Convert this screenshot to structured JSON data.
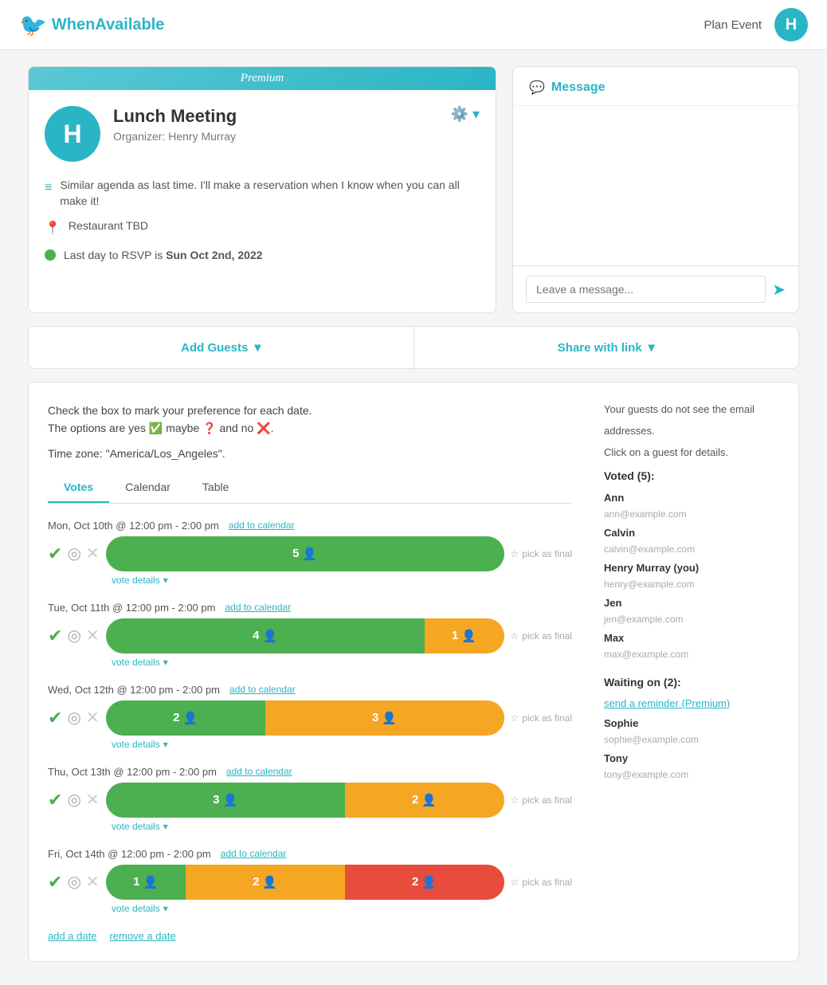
{
  "header": {
    "logo_text": "WhenAvailable",
    "plan_event": "Plan Event",
    "user_initial": "H"
  },
  "event_card": {
    "premium_label": "Premium",
    "title": "Lunch Meeting",
    "organizer": "Organizer: Henry Murray",
    "user_initial": "H",
    "description": "Similar agenda as last time. I'll make a reservation when I know when you can all make it!",
    "location": "Restaurant TBD",
    "rsvp_text": "Last day to RSVP is ",
    "rsvp_date": "Sun Oct 2nd, 2022"
  },
  "message_panel": {
    "title": "Message",
    "placeholder": "Leave a message..."
  },
  "actions": {
    "add_guests": "Add Guests",
    "share_link": "Share with link"
  },
  "voting": {
    "instruction1": "Check the box to mark your preference for each date.",
    "instruction2": "The options are yes",
    "instruction3": "maybe",
    "instruction4": "and no",
    "timezone_label": "Time zone:",
    "timezone_value": "\"America/Los_Angeles\"",
    "tabs": [
      "Votes",
      "Calendar",
      "Table"
    ],
    "active_tab": "Votes",
    "dates": [
      {
        "label": "Mon, Oct 10th @ 12:00 pm - 2:00 pm",
        "green_count": 5,
        "yellow_count": 0,
        "red_count": 0,
        "green_pct": 100,
        "yellow_pct": 0,
        "red_pct": 0,
        "pick_label": "pick as final"
      },
      {
        "label": "Tue, Oct 11th @ 12:00 pm - 2:00 pm",
        "green_count": 4,
        "yellow_count": 1,
        "red_count": 0,
        "green_pct": 80,
        "yellow_pct": 20,
        "red_pct": 0,
        "pick_label": "pick as final"
      },
      {
        "label": "Wed, Oct 12th @ 12:00 pm - 2:00 pm",
        "green_count": 2,
        "yellow_count": 3,
        "red_count": 0,
        "green_pct": 40,
        "yellow_pct": 60,
        "red_pct": 0,
        "pick_label": "pick as final"
      },
      {
        "label": "Thu, Oct 13th @ 12:00 pm - 2:00 pm",
        "green_count": 3,
        "yellow_count": 2,
        "red_count": 0,
        "green_pct": 60,
        "yellow_pct": 40,
        "red_pct": 0,
        "pick_label": "pick as final"
      },
      {
        "label": "Fri, Oct 14th @ 12:00 pm - 2:00 pm",
        "green_count": 1,
        "yellow_count": 2,
        "red_count": 2,
        "green_pct": 20,
        "yellow_pct": 40,
        "red_pct": 40,
        "pick_label": "pick as final"
      }
    ],
    "add_date": "add a date",
    "remove_date": "remove a date",
    "vote_details": "vote details"
  },
  "sidebar": {
    "privacy_note1": "Your guests do not see the email",
    "privacy_note2": "addresses.",
    "click_note": "Click on a guest for details.",
    "voted_label": "Voted (5):",
    "waiting_label": "Waiting on (2):",
    "reminder_link": "send a reminder (Premium)",
    "voted_guests": [
      {
        "name": "Ann",
        "email": "ann@example.com"
      },
      {
        "name": "Calvin",
        "email": "calvin@example.com"
      },
      {
        "name": "Henry Murray (you)",
        "email": "henry@example.com"
      },
      {
        "name": "Jen",
        "email": "jen@example.com"
      },
      {
        "name": "Max",
        "email": "max@example.com"
      }
    ],
    "waiting_guests": [
      {
        "name": "Sophie",
        "email": "sophie@example.com"
      },
      {
        "name": "Tony",
        "email": "tony@example.com"
      }
    ]
  }
}
